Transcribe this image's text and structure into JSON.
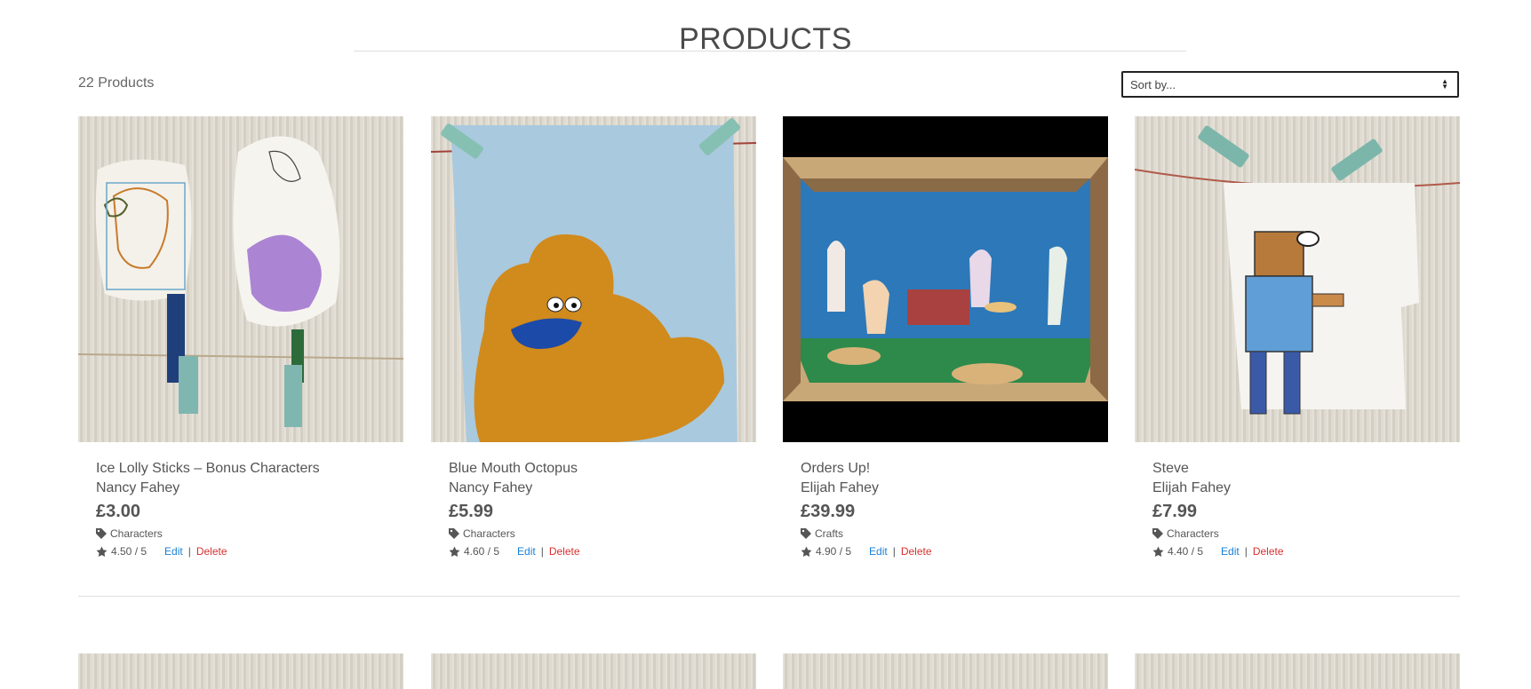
{
  "page": {
    "title": "PRODUCTS",
    "product_count": "22 Products",
    "sort": {
      "selected": "Sort by..."
    }
  },
  "products": [
    {
      "name": "Ice Lolly Sticks – Bonus Characters",
      "artist": "Nancy Fahey",
      "price": "£3.00",
      "category": "Characters",
      "rating": "4.50 / 5",
      "edit_label": "Edit",
      "separator": "|",
      "delete_label": "Delete"
    },
    {
      "name": "Blue Mouth Octopus",
      "artist": "Nancy Fahey",
      "price": "£5.99",
      "category": "Characters",
      "rating": "4.60 / 5",
      "edit_label": "Edit",
      "separator": "|",
      "delete_label": "Delete"
    },
    {
      "name": "Orders Up!",
      "artist": "Elijah Fahey",
      "price": "£39.99",
      "category": "Crafts",
      "rating": "4.90 / 5",
      "edit_label": "Edit",
      "separator": "|",
      "delete_label": "Delete"
    },
    {
      "name": "Steve",
      "artist": "Elijah Fahey",
      "price": "£7.99",
      "category": "Characters",
      "rating": "4.40 / 5",
      "edit_label": "Edit",
      "separator": "|",
      "delete_label": "Delete"
    }
  ],
  "colors": {
    "edit": "#1a7fd6",
    "delete": "#d63030",
    "text": "#555555"
  },
  "icons": [
    "tag-icon",
    "star-icon",
    "sort-arrows-icon"
  ]
}
